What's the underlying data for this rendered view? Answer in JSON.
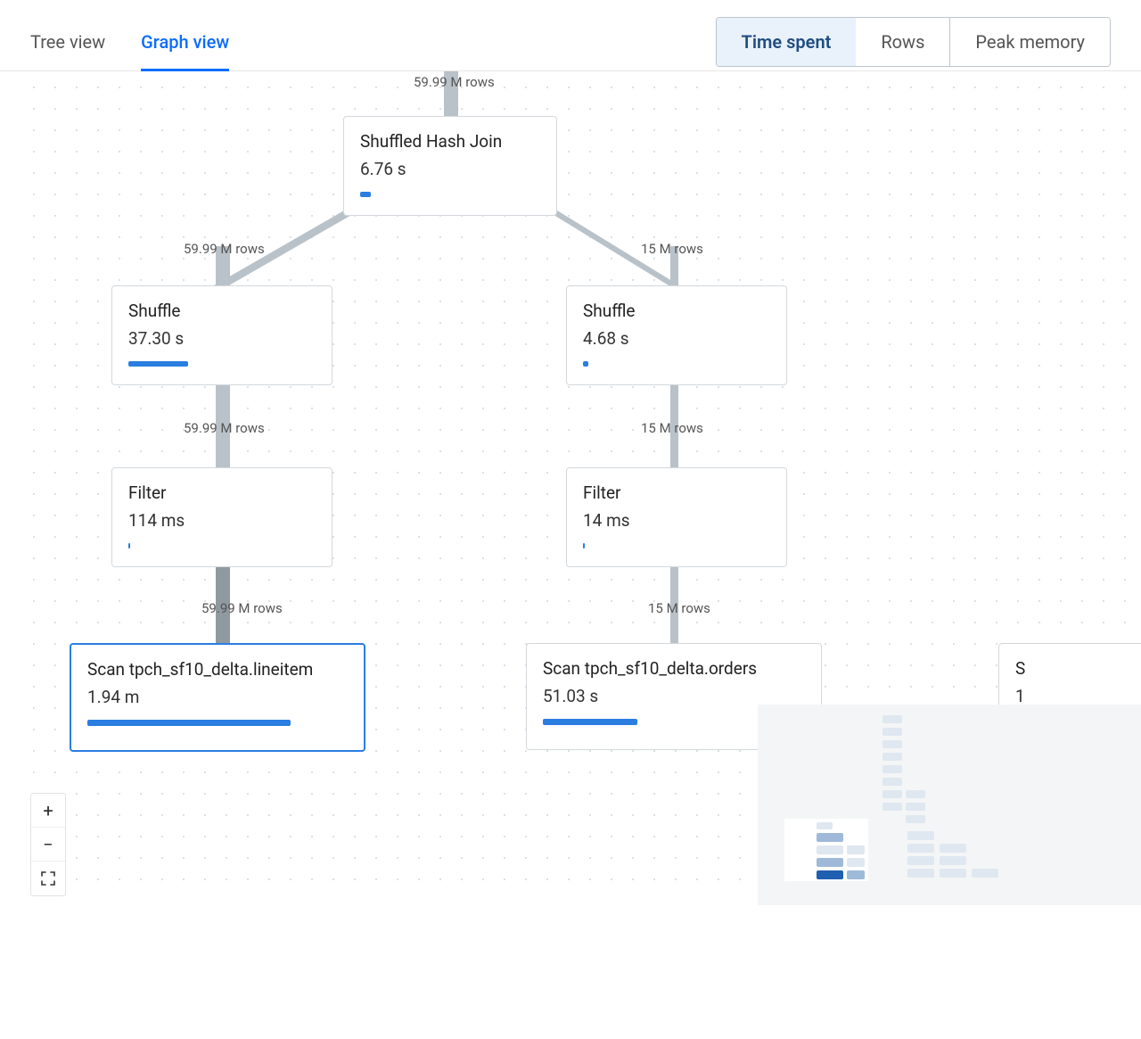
{
  "tabs": {
    "tree": "Tree view",
    "graph": "Graph view"
  },
  "metrics": {
    "time": "Time spent",
    "rows": "Rows",
    "memory": "Peak memory"
  },
  "colors": {
    "accent": "#2a7de1"
  },
  "graph": {
    "top_rows": "59.99 M rows",
    "nodes": {
      "join": {
        "title": "Shuffled Hash Join",
        "metric": "6.76 s",
        "bar_pct": 6
      },
      "shuffle_left": {
        "title": "Shuffle",
        "metric": "37.30 s",
        "bar_pct": 32,
        "in_rows": "59.99 M rows"
      },
      "shuffle_right": {
        "title": "Shuffle",
        "metric": "4.68 s",
        "bar_pct": 3,
        "in_rows": "15 M rows"
      },
      "filter_left": {
        "title": "Filter",
        "metric": "114 ms",
        "bar_pct": 1,
        "in_rows": "59.99 M rows"
      },
      "filter_right": {
        "title": "Filter",
        "metric": "14 ms",
        "bar_pct": 1,
        "in_rows": "15 M rows"
      },
      "scan_left": {
        "title": "Scan tpch_sf10_delta.lineitem",
        "metric": "1.94 m",
        "bar_pct": 78,
        "in_rows": "59.99 M rows"
      },
      "scan_right": {
        "title": "Scan tpch_sf10_delta.orders",
        "metric": "51.03 s",
        "bar_pct": 36,
        "in_rows": "15 M rows"
      },
      "scan_far": {
        "title_prefix": "S",
        "metric_prefix": "1"
      }
    }
  }
}
